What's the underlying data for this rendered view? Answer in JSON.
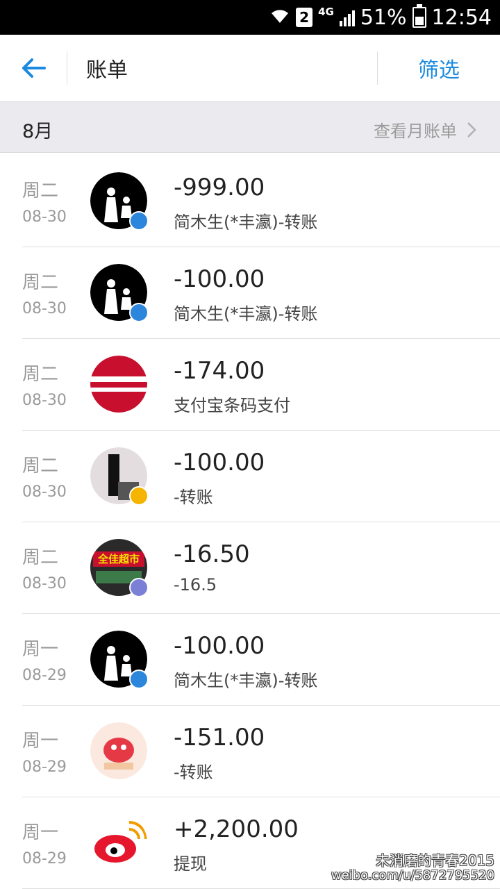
{
  "status_bar": {
    "network": "4G",
    "sim_slot": "2",
    "battery": "51%",
    "time": "12:54"
  },
  "app_bar": {
    "title": "账单",
    "filter_label": "筛选"
  },
  "month_header": {
    "month": "8月",
    "link_label": "查看月账单"
  },
  "transactions": [
    {
      "day": "周二",
      "date": "08-30",
      "amount": "-999.00",
      "desc": "简木生(*丰瀛)-转账",
      "avatar": "couple-silhouette-avatar",
      "badge_color": "#2b86dc"
    },
    {
      "day": "周二",
      "date": "08-30",
      "amount": "-100.00",
      "desc": "简木生(*丰瀛)-转账",
      "avatar": "couple-silhouette-avatar",
      "badge_color": "#2b86dc"
    },
    {
      "day": "周二",
      "date": "08-30",
      "amount": "-174.00",
      "desc": "支付宝条码支付",
      "avatar": "red-merchant-avatar",
      "badge_color": ""
    },
    {
      "day": "周二",
      "date": "08-30",
      "amount": "-100.00",
      "desc": "-转账",
      "avatar": "person-photo-avatar",
      "badge_color": "#f4b400"
    },
    {
      "day": "周二",
      "date": "08-30",
      "amount": "-16.50",
      "desc": "-16.5",
      "avatar": "supermarket-avatar",
      "badge_color": "#7b7fd6",
      "avatar_text": "全佳超市"
    },
    {
      "day": "周一",
      "date": "08-29",
      "amount": "-100.00",
      "desc": "简木生(*丰瀛)-转账",
      "avatar": "couple-silhouette-avatar",
      "badge_color": "#2b86dc"
    },
    {
      "day": "周一",
      "date": "08-29",
      "amount": "-151.00",
      "desc": "-转账",
      "avatar": "cartoon-avatar",
      "badge_color": ""
    },
    {
      "day": "周一",
      "date": "08-29",
      "amount": "+2,200.00",
      "desc": "提现",
      "avatar": "weibo-logo-avatar",
      "badge_color": ""
    }
  ],
  "watermark": {
    "line1": "未消磨的青春2015",
    "line2": "weibo.com/u/5872795520"
  },
  "colors": {
    "accent": "#1a8ae0",
    "month_bar": "#ebebef"
  }
}
